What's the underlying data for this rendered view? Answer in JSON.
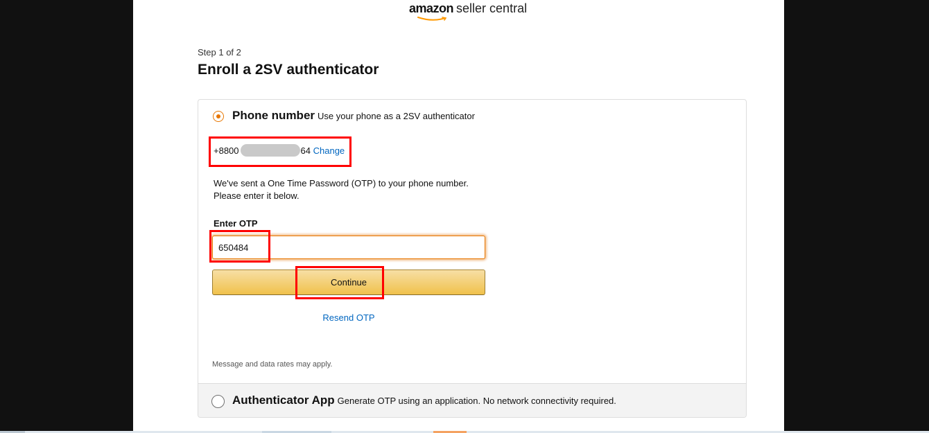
{
  "header": {
    "logo_brand": "amazon",
    "logo_rest": "seller central"
  },
  "step_label": "Step 1 of 2",
  "title": "Enroll a 2SV authenticator",
  "phone_option": {
    "title": "Phone number",
    "description": "Use your phone as a 2SV authenticator",
    "selected": true,
    "phone_prefix": "+8800",
    "phone_suffix": "64",
    "change_link": "Change",
    "info_text": "We've sent a One Time Password (OTP) to your phone number. Please enter it below.",
    "otp_label": "Enter OTP",
    "otp_value": "650484",
    "continue_label": "Continue",
    "resend_label": "Resend OTP",
    "disclaimer": "Message and data rates may apply."
  },
  "app_option": {
    "title": "Authenticator App",
    "description": "Generate OTP using an application. No network connectivity required.",
    "selected": false
  },
  "colors": {
    "accent_orange": "#e77600",
    "button_yellow": "#f0c14b",
    "link_blue": "#0066c0",
    "highlight_red": "#ff0000",
    "amazon_smile": "#ff9900"
  }
}
